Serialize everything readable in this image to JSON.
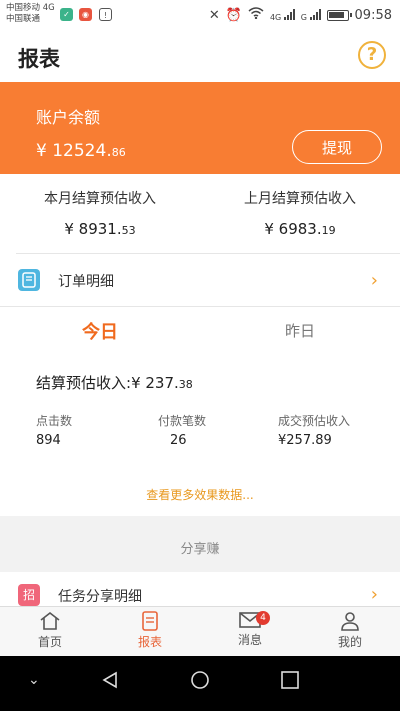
{
  "status_bar": {
    "carrier_1": "中国移动 4G",
    "carrier_2": "中国联通",
    "time": "09:58",
    "network_labels": [
      "4G",
      "G"
    ]
  },
  "header": {
    "title": "报表",
    "help_glyph": "?"
  },
  "balance": {
    "label": "账户余额",
    "currency": "¥",
    "integer": "12524.",
    "decimal": "86",
    "withdraw_label": "提现"
  },
  "estimates": {
    "this_month": {
      "label": "本月结算预估收入",
      "prefix": "¥ ",
      "integer": "8931.",
      "decimal": "53"
    },
    "last_month": {
      "label": "上月结算预估收入",
      "prefix": "¥ ",
      "integer": "6983.",
      "decimal": "19"
    }
  },
  "order_row": {
    "label": "订单明细",
    "icon": "order-icon"
  },
  "tabs": {
    "today": "今日",
    "yesterday": "昨日"
  },
  "settle": {
    "label": "结算预估收入:",
    "prefix": "¥ ",
    "integer": "237.",
    "decimal": "38"
  },
  "metrics": [
    {
      "label": "点击数",
      "value": "894"
    },
    {
      "label": "付款笔数",
      "value": "26"
    },
    {
      "label": "成交预估收入",
      "value": "¥257.89"
    }
  ],
  "more_link": "查看更多效果数据...",
  "share_section": {
    "title": "分享赚"
  },
  "task_row": {
    "label": "任务分享明细",
    "icon_char": "招"
  },
  "bottom_nav": [
    {
      "label": "首页",
      "icon": "home-icon"
    },
    {
      "label": "报表",
      "icon": "report-icon"
    },
    {
      "label": "消息",
      "icon": "mail-icon",
      "badge": "4"
    },
    {
      "label": "我的",
      "icon": "person-icon"
    }
  ],
  "colors": {
    "accent": "#f87d33",
    "active_tab": "#f06a1e",
    "link": "#e8981e",
    "badge": "#e23b30"
  }
}
